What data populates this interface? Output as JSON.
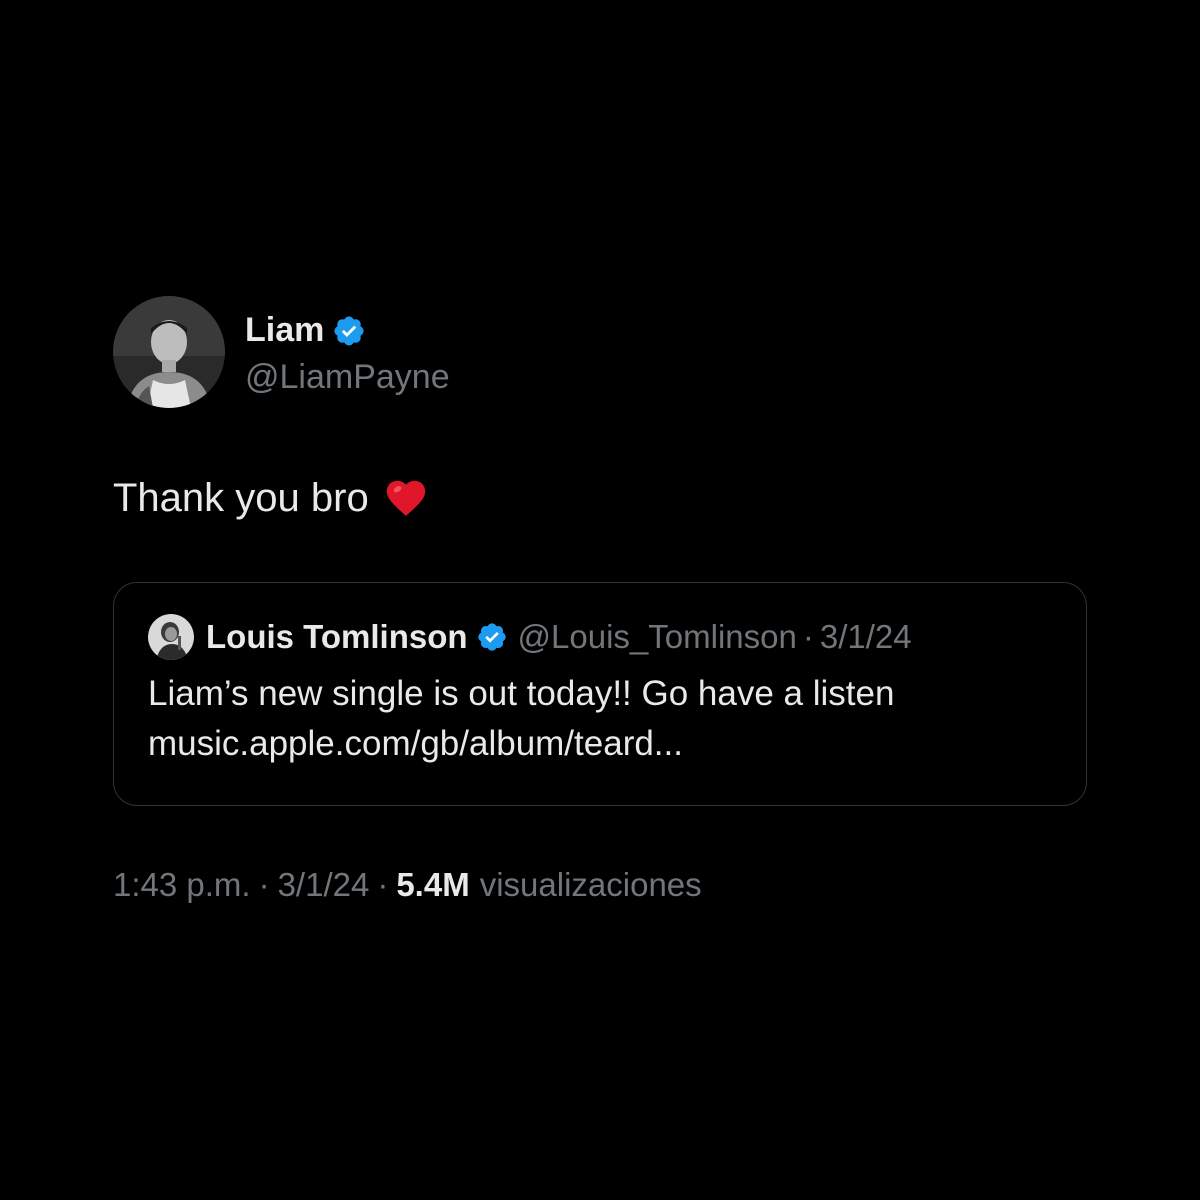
{
  "tweet": {
    "author": {
      "display_name": "Liam",
      "handle": "@LiamPayne",
      "verified": true,
      "avatar_icon": "profile-photo"
    },
    "text": "Thank you bro",
    "emoji": "red-heart",
    "quoted": {
      "author_name": "Louis Tomlinson",
      "handle": "@Louis_Tomlinson",
      "separator": "·",
      "date": "3/1/24",
      "text": "Liam’s new single is out today!! Go have a listen",
      "link": "music.apple.com/gb/album/teard..."
    },
    "meta": {
      "time": "1:43 p.m.",
      "separator": "·",
      "date": "3/1/24",
      "views_count": "5.4M",
      "views_label": "visualizaciones"
    }
  },
  "colors": {
    "background": "#000000",
    "primary_text": "#e7e9ea",
    "secondary_text": "#71767b",
    "verified_blue": "#1d9bf0",
    "heart_red": "#e0162b",
    "border": "#2f3336"
  }
}
